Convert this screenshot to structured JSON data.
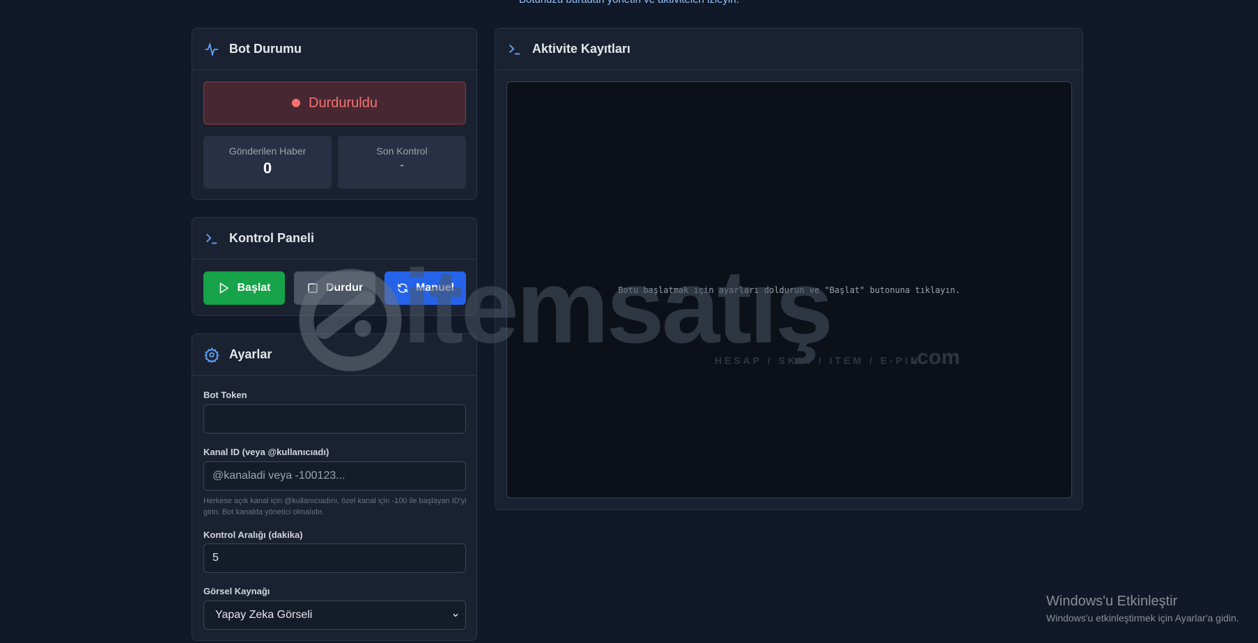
{
  "header": {
    "subtitle": "Botunuzu buradan yönetin ve aktiviteleri izleyin."
  },
  "status_card": {
    "title": "Bot Durumu",
    "status": "Durduruldu",
    "stats": [
      {
        "label": "Gönderilen Haber",
        "value": "0"
      },
      {
        "label": "Son Kontrol",
        "value": "-"
      }
    ]
  },
  "control_card": {
    "title": "Kontrol Paneli",
    "buttons": {
      "start": "Başlat",
      "stop": "Durdur",
      "manual": "Manuel"
    }
  },
  "settings_card": {
    "title": "Ayarlar",
    "bot_token": {
      "label": "Bot Token",
      "value": ""
    },
    "channel": {
      "label": "Kanal ID (veya @kullanıcıadı)",
      "placeholder": "@kanaladi veya -100123...",
      "help": "Herkese açık kanal için @kullanıcıadını, özel kanal için -100 ile başlayan ID'yi girin. Bot kanalda yönetici olmalıdır."
    },
    "interval": {
      "label": "Kontrol Aralığı (dakika)",
      "value": "5"
    },
    "image_source": {
      "label": "Görsel Kaynağı",
      "selected": "Yapay Zeka Görseli"
    }
  },
  "log_card": {
    "title": "Aktivite Kayıtları",
    "empty": "Botu başlatmak için ayarları doldurun ve \"Başlat\" butonuna tıklayın."
  },
  "watermark": {
    "brand": "itemsatış",
    "tagline": "HESAP / SKIN / ITEM / E-PIN",
    "tld": ".com"
  },
  "windows": {
    "title": "Windows'u Etkinleştir",
    "subtitle": "Windows'u etkinleştirmek için Ayarlar'a gidin."
  },
  "colors": {
    "accent": "#60a5fa",
    "start": "#16a34a",
    "stop": "#4b5563",
    "manual": "#2563eb",
    "danger": "#f87171"
  }
}
